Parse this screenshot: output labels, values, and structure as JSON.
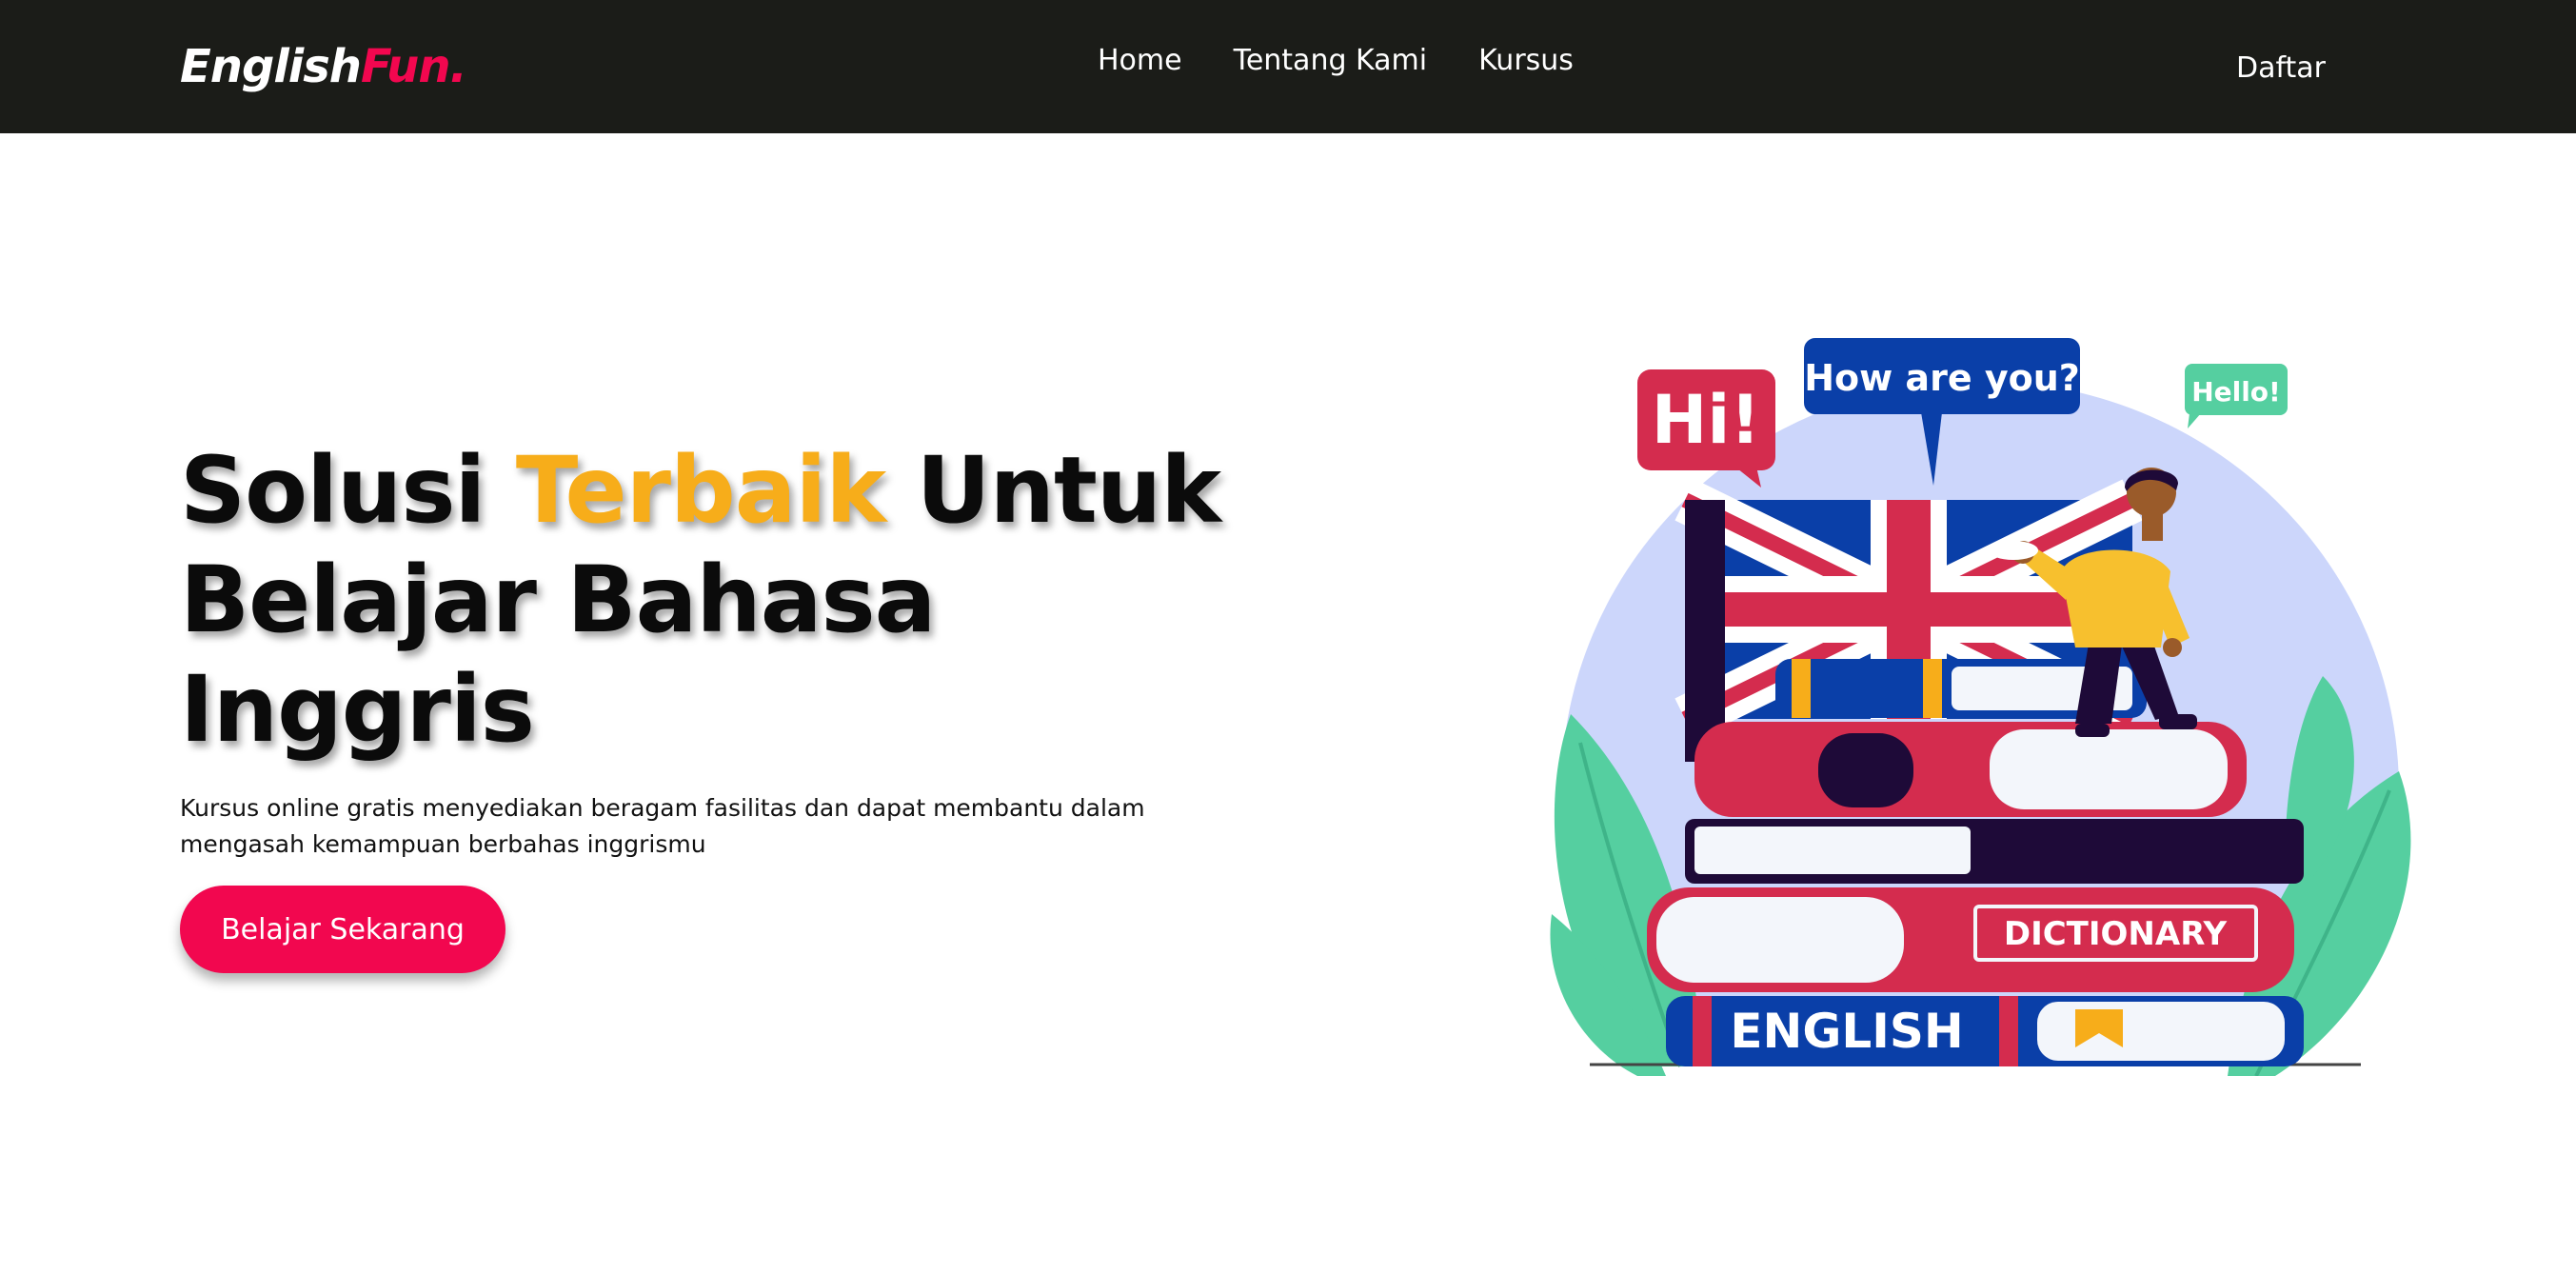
{
  "brand": {
    "name_part1": "English",
    "name_part2": "Fun."
  },
  "nav": {
    "links": [
      {
        "label": "Home"
      },
      {
        "label": "Tentang Kami"
      },
      {
        "label": "Kursus"
      }
    ],
    "signup_label": "Daftar"
  },
  "hero": {
    "title_part1": "Solusi ",
    "title_highlight": "Terbaik",
    "title_part2": " Untuk Belajar Bahasa Inggris",
    "description": "Kursus online gratis menyediakan beragam fasilitas dan dapat membantu dalam mengasah kemampuan berbahas inggrismu",
    "cta_label": "Belajar Sekarang"
  },
  "illustration": {
    "bubble_hi": "Hi!",
    "bubble_how": "How are you?",
    "bubble_hello": "Hello!",
    "book_dictionary": "DICTIONARY",
    "book_english": "ENGLISH"
  },
  "colors": {
    "navbar_bg": "#1b1c18",
    "brand_accent": "#f2074f",
    "title_highlight": "#f7ad1a",
    "cta_bg": "#f2074f"
  }
}
